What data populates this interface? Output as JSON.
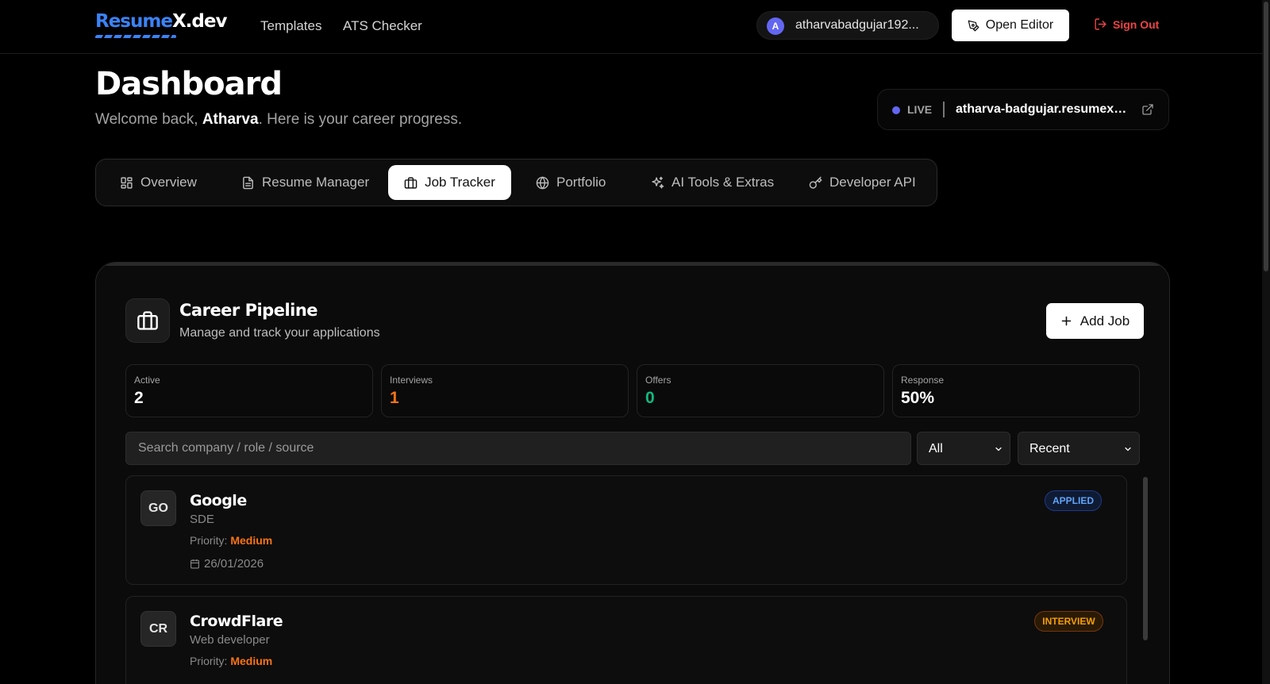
{
  "brand": {
    "logo_part1": "Resume",
    "logo_part2": "X.dev",
    "accent": "#3b82f6"
  },
  "nav": {
    "templates": "Templates",
    "ats": "ATS Checker"
  },
  "user": {
    "initial": "A",
    "name": "atharvabadgujar192..."
  },
  "actions": {
    "open_editor": "Open Editor",
    "sign_out": "Sign Out"
  },
  "header": {
    "title": "Dashboard",
    "welcome_prefix": "Welcome back, ",
    "welcome_name": "Atharva",
    "welcome_suffix": ". Here is your career progress."
  },
  "live": {
    "label": "LIVE",
    "url": "atharva-badgujar.resumex.dev"
  },
  "tabs": [
    {
      "label": "Overview",
      "icon": "grid-icon"
    },
    {
      "label": "Resume Manager",
      "icon": "file-icon"
    },
    {
      "label": "Job Tracker",
      "icon": "briefcase-icon",
      "active": true
    },
    {
      "label": "Portfolio",
      "icon": "globe-icon"
    },
    {
      "label": "AI Tools & Extras",
      "icon": "sparkles-icon"
    },
    {
      "label": "Developer API",
      "icon": "key-icon"
    }
  ],
  "pipeline": {
    "title": "Career Pipeline",
    "subtitle": "Manage and track your applications",
    "add_job": "Add Job",
    "stats": [
      {
        "label": "Active",
        "value": "2",
        "color": "#ffffff"
      },
      {
        "label": "Interviews",
        "value": "1",
        "color": "#f97316"
      },
      {
        "label": "Offers",
        "value": "0",
        "color": "#10b981"
      },
      {
        "label": "Response",
        "value": "50%",
        "color": "#ffffff"
      }
    ],
    "search_placeholder": "Search company / role / source",
    "filter_value": "All",
    "sort_value": "Recent",
    "jobs": [
      {
        "initials": "GO",
        "company": "Google",
        "role": "SDE",
        "priority_label": "Priority: ",
        "priority": "Medium",
        "date": "26/01/2026",
        "status": "APPLIED",
        "status_color": "#60a5fa",
        "status_bg": "#0f1a33",
        "status_border": "#1e3a8a"
      },
      {
        "initials": "CR",
        "company": "CrowdFlare",
        "role": "Web developer",
        "priority_label": "Priority: ",
        "priority": "Medium",
        "date": "",
        "status": "INTERVIEW",
        "status_color": "#f59e0b",
        "status_bg": "#2a1a05",
        "status_border": "#78350f"
      }
    ]
  }
}
